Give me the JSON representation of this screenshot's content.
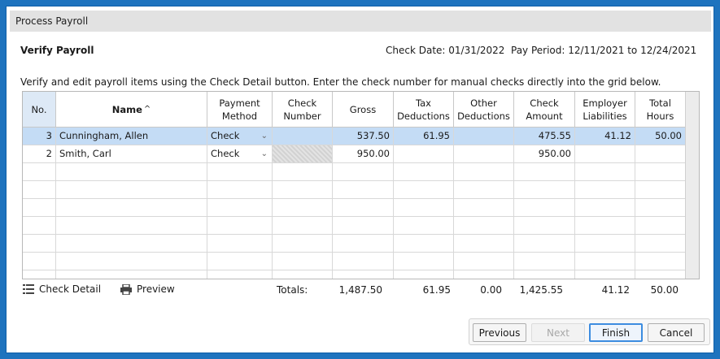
{
  "window": {
    "title": "Process Payroll"
  },
  "header": {
    "heading": "Verify Payroll",
    "check_date": "Check Date: 01/31/2022",
    "pay_period": "Pay Period: 12/11/2021 to 12/24/2021"
  },
  "instructions": "Verify and edit payroll items using the Check Detail button. Enter the check number for manual checks directly into the grid below.",
  "grid": {
    "columns": [
      {
        "line1": "No.",
        "line2": ""
      },
      {
        "line1": "Name",
        "line2": ""
      },
      {
        "line1": "Payment",
        "line2": "Method"
      },
      {
        "line1": "Check",
        "line2": "Number"
      },
      {
        "line1": "Gross",
        "line2": ""
      },
      {
        "line1": "Tax",
        "line2": "Deductions"
      },
      {
        "line1": "Other",
        "line2": "Deductions"
      },
      {
        "line1": "Check",
        "line2": "Amount"
      },
      {
        "line1": "Employer",
        "line2": "Liabilities"
      },
      {
        "line1": "Total",
        "line2": "Hours"
      }
    ],
    "sort_indicator": "^",
    "rows": [
      {
        "no": "3",
        "name": "Cunningham, Allen",
        "payment_method": "Check",
        "check_number": "",
        "gross": "537.50",
        "tax": "61.95",
        "other": "",
        "amount": "475.55",
        "liabilities": "41.12",
        "hours": "50.00",
        "selected": true
      },
      {
        "no": "2",
        "name": "Smith, Carl",
        "payment_method": "Check",
        "check_number": "",
        "gross": "950.00",
        "tax": "",
        "other": "",
        "amount": "950.00",
        "liabilities": "",
        "hours": "",
        "selected": false
      }
    ]
  },
  "toolbar": {
    "check_detail": "Check Detail",
    "preview": "Preview"
  },
  "totals": {
    "label": "Totals:",
    "gross": "1,487.50",
    "tax": "61.95",
    "other": "0.00",
    "amount": "1,425.55",
    "liabilities": "41.12",
    "hours": "50.00"
  },
  "buttons": {
    "previous": "Previous",
    "next": "Next",
    "finish": "Finish",
    "cancel": "Cancel"
  },
  "icons": {
    "list": "list-icon",
    "printer": "printer-icon",
    "dropdown": "chevron-down-icon"
  },
  "colors": {
    "frame": "#1e73be",
    "selection": "#c4dcf5",
    "no_header": "#dde9f6",
    "focus": "#3c8ce0"
  }
}
